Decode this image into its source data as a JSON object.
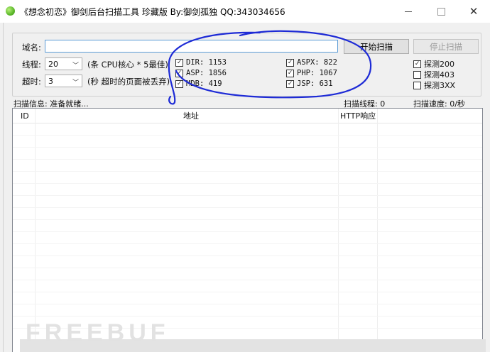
{
  "window": {
    "title": "《想念初恋》御剑后台扫描工具 珍藏版 By:御剑孤独 QQ:343034656",
    "minimize_label": "—",
    "maximize_label": "□",
    "close_label": "✕"
  },
  "form": {
    "domain_label": "域名:",
    "domain_value": "",
    "threads_label": "线程:",
    "threads_value": "20",
    "threads_hint": "(条 CPU核心 * 5最佳)",
    "timeout_label": "超时:",
    "timeout_value": "3",
    "timeout_hint": "(秒 超时的页面被丢弃)"
  },
  "buttons": {
    "start": "开始扫描",
    "stop": "停止扫描"
  },
  "dictionaries": [
    {
      "label": "DIR: 1153",
      "checked": true
    },
    {
      "label": "ASP: 1856",
      "checked": true
    },
    {
      "label": "MDB: 419",
      "checked": true
    },
    {
      "label": "ASPX: 822",
      "checked": true
    },
    {
      "label": "PHP: 1067",
      "checked": true
    },
    {
      "label": "JSP: 631",
      "checked": true
    }
  ],
  "probes": [
    {
      "label": "探测200",
      "checked": true
    },
    {
      "label": "探测403",
      "checked": false
    },
    {
      "label": "探测3XX",
      "checked": false
    }
  ],
  "status": {
    "info": "扫描信息: 准备就绪...",
    "threads": "扫描线程: 0",
    "speed": "扫描速度: 0/秒"
  },
  "table": {
    "columns": [
      "ID",
      "地址",
      "HTTP响应"
    ]
  },
  "watermark": "FREEBUF"
}
